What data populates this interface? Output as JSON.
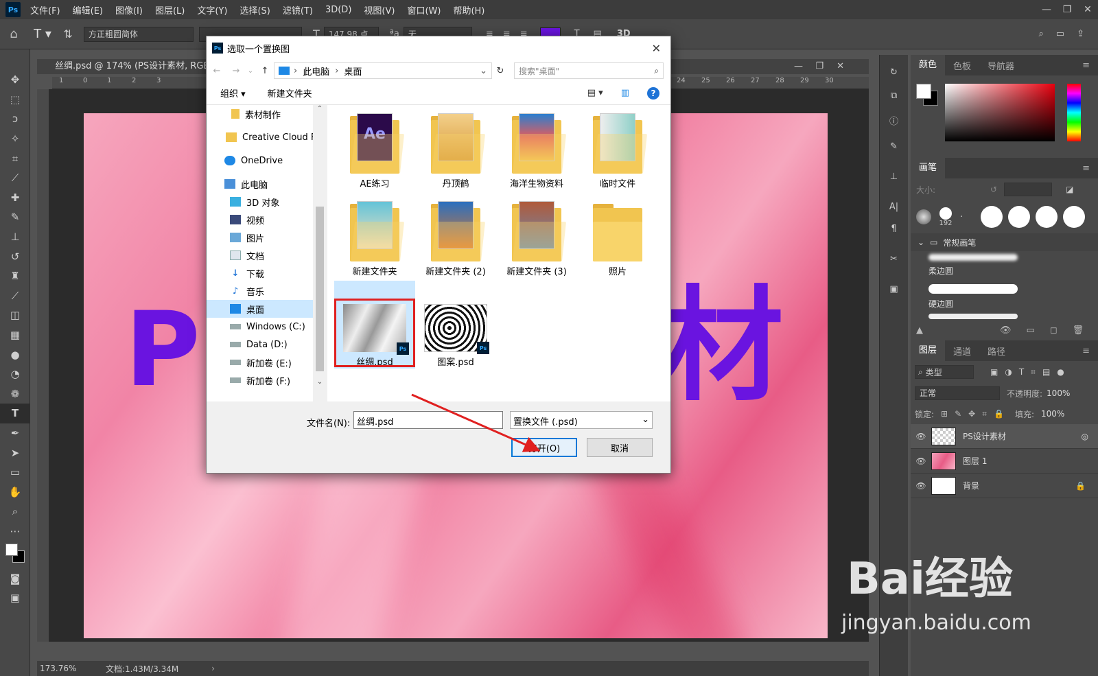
{
  "menubar": {
    "logo": "Ps",
    "items": [
      "文件(F)",
      "编辑(E)",
      "图像(I)",
      "图层(L)",
      "文字(Y)",
      "选择(S)",
      "滤镜(T)",
      "3D(D)",
      "视图(V)",
      "窗口(W)",
      "帮助(H)"
    ]
  },
  "options": {
    "font_family": "方正粗圆简体",
    "font_size": "147.98 点",
    "aa_value": "无",
    "mode_3d": "3D"
  },
  "document": {
    "tab_title": "丝绸.psd @ 174% (PS设计素材, RGB/",
    "zoom": "173.76%",
    "doc_size": "文档:1.43M/3.34M",
    "art_text_left": "PS",
    "art_text_right": "材",
    "text_color": "#6a14e0",
    "ruler_h": [
      "1",
      "0",
      "1",
      "2",
      "3",
      "4",
      "24",
      "25",
      "26",
      "27",
      "28",
      "29",
      "30"
    ],
    "ruler_v": [
      "1",
      "0",
      "1",
      "2",
      "3",
      "4",
      "5",
      "6",
      "7",
      "8",
      "9",
      "1 0",
      "1 1",
      "1 2",
      "1 3",
      "1 4",
      "1 5",
      "1 6",
      "1 7",
      "1 8",
      "1 9",
      "2 0",
      "2 1"
    ]
  },
  "dialog": {
    "title": "选取一个置换图",
    "path": [
      "此电脑",
      "桌面"
    ],
    "search_placeholder": "搜索\"桌面\"",
    "organize": "组织 ▾",
    "new_folder": "新建文件夹",
    "nav_items": [
      {
        "label": "素材制作",
        "icon": "folder-icon"
      },
      {
        "label": "Creative Cloud F",
        "icon": "creative-cloud-icon"
      },
      {
        "label": "OneDrive",
        "icon": "onedrive-icon"
      },
      {
        "label": "此电脑",
        "icon": "computer-icon"
      },
      {
        "label": "3D 对象",
        "icon": "3d-objects-icon"
      },
      {
        "label": "视频",
        "icon": "video-icon"
      },
      {
        "label": "图片",
        "icon": "pictures-icon"
      },
      {
        "label": "文档",
        "icon": "documents-icon"
      },
      {
        "label": "下载",
        "icon": "download-icon"
      },
      {
        "label": "音乐",
        "icon": "music-icon"
      },
      {
        "label": "桌面",
        "icon": "desktop-icon"
      },
      {
        "label": "Windows (C:)",
        "icon": "drive-icon"
      },
      {
        "label": "Data (D:)",
        "icon": "drive-icon"
      },
      {
        "label": "新加卷 (E:)",
        "icon": "drive-icon"
      },
      {
        "label": "新加卷 (F:)",
        "icon": "drive-icon"
      }
    ],
    "selected_nav": "桌面",
    "files": [
      {
        "name": "AE练习",
        "type": "folder",
        "accent": "#2b0a4a"
      },
      {
        "name": "丹顶鹤",
        "type": "folder",
        "accent": "#d89a3a"
      },
      {
        "name": "海洋生物资料",
        "type": "folder",
        "accent": "#2a7fcf"
      },
      {
        "name": "临时文件",
        "type": "folder",
        "accent": "#8fd0c8"
      },
      {
        "name": "新建文件夹",
        "type": "folder",
        "accent": "#63c3d8"
      },
      {
        "name": "新建文件夹 (2)",
        "type": "folder",
        "accent": "#e07a2a"
      },
      {
        "name": "新建文件夹 (3)",
        "type": "folder",
        "accent": "#b05a3a"
      },
      {
        "name": "照片",
        "type": "folder",
        "accent": "#f1c550"
      },
      {
        "name": "丝绸.psd",
        "type": "psd",
        "selected": true
      },
      {
        "name": "图案.psd",
        "type": "psd"
      }
    ],
    "filename_label": "文件名(N):",
    "filename_value": "丝绸.psd",
    "filetype_value": "置换文件 (.psd)",
    "open_button": "打开(O)",
    "cancel_button": "取消"
  },
  "right_panel": {
    "color_tabs": [
      "颜色",
      "色板",
      "导航器"
    ],
    "brush_tab": "画笔",
    "brush_size_label": "大小:",
    "brush_size_preset": "192",
    "brush_group": "常规画笔",
    "brushes": [
      "柔边圆",
      "硬边圆"
    ],
    "layers_tabs": [
      "图层",
      "通道",
      "路径"
    ],
    "filter_kind": "类型",
    "blend_mode": "正常",
    "opacity_label": "不透明度:",
    "opacity_value": "100%",
    "lock_label": "锁定:",
    "fill_label": "填充:",
    "fill_value": "100%",
    "layers": [
      {
        "name": "PS设计素材"
      },
      {
        "name": "图层 1"
      },
      {
        "name": "背景"
      }
    ]
  },
  "watermark": {
    "brand": "Bai经验",
    "url": "jingyan.baidu.com"
  }
}
